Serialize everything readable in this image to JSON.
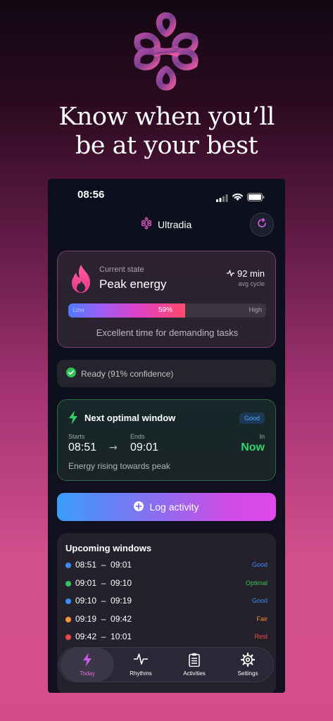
{
  "headline": {
    "line1": "Know when you’ll",
    "line2": "be at your best"
  },
  "status_bar": {
    "time": "08:56"
  },
  "header": {
    "app_name": "Ultradia",
    "refresh_icon": "refresh-icon",
    "brand_icon": "ultradia-logo-icon"
  },
  "current_state": {
    "label": "Current state",
    "value": "Peak energy",
    "cycle_value": "92 min",
    "cycle_label": "avg cycle",
    "energy_percent": 59,
    "energy_percent_label": "59%",
    "low_label": "Low",
    "high_label": "High",
    "description": "Excellent time for demanding tasks"
  },
  "readiness": {
    "text": "Ready (91% confidence)"
  },
  "next_window": {
    "title": "Next optimal window",
    "badge": "Good",
    "starts_label": "Starts",
    "starts_value": "08:51",
    "ends_label": "Ends",
    "ends_value": "09:01",
    "in_label": "In",
    "in_value": "Now",
    "description": "Energy rising towards peak"
  },
  "log_button": {
    "label": "Log activity"
  },
  "upcoming": {
    "title": "Upcoming windows",
    "rows": [
      {
        "start": "08:51",
        "end": "09:01",
        "status": "Good",
        "color": "#3b8bf5"
      },
      {
        "start": "09:01",
        "end": "09:10",
        "status": "Optimal",
        "color": "#36c25a"
      },
      {
        "start": "09:10",
        "end": "09:19",
        "status": "Good",
        "color": "#3b8bf5"
      },
      {
        "start": "09:19",
        "end": "09:42",
        "status": "Fair",
        "color": "#f0943a"
      },
      {
        "start": "09:42",
        "end": "10:01",
        "status": "Rest",
        "color": "#ec4848"
      }
    ]
  },
  "tabs": [
    {
      "label": "Today",
      "icon": "bolt-icon",
      "active": true
    },
    {
      "label": "Rhythms",
      "icon": "pulse-icon",
      "active": false
    },
    {
      "label": "Activities",
      "icon": "clipboard-icon",
      "active": false
    },
    {
      "label": "Settings",
      "icon": "gear-icon",
      "active": false
    }
  ],
  "colors": {
    "accent_pink": "#e04ae8",
    "good_blue": "#3b8bf5",
    "optimal_green": "#36c25a",
    "now_green": "#34d46c"
  }
}
